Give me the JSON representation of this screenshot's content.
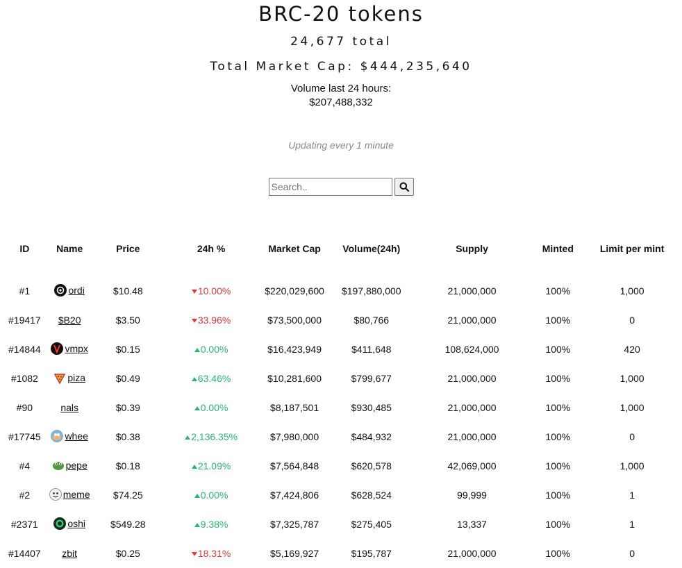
{
  "page": {
    "title": "BRC-20 tokens",
    "total": "24,677 total",
    "market_cap": "Total Market Cap: $444,235,640",
    "volume_label": "Volume last 24 hours:",
    "volume_value": "$207,488,332",
    "updating": "Updating every 1 minute"
  },
  "search": {
    "placeholder": "Search.."
  },
  "table": {
    "headers": [
      "ID",
      "Name",
      "Price",
      "24h %",
      "Market Cap",
      "Volume(24h)",
      "Supply",
      "Minted",
      "Limit per mint"
    ],
    "rows": [
      {
        "id": "#1",
        "name": "ordi",
        "icon": "ordi-logo-icon",
        "price": "$10.48",
        "change": "10.00%",
        "direction": "down",
        "market_cap": "$220,029,600",
        "volume": "$197,880,000",
        "supply": "21,000,000",
        "minted": "100%",
        "limit": "1,000"
      },
      {
        "id": "#19417",
        "name": "$B20",
        "icon": "",
        "price": "$3.50",
        "change": "33.96%",
        "direction": "down",
        "market_cap": "$73,500,000",
        "volume": "$80,766",
        "supply": "21,000,000",
        "minted": "100%",
        "limit": "0"
      },
      {
        "id": "#14844",
        "name": "vmpx",
        "icon": "vmpx-logo-icon",
        "price": "$0.15",
        "change": "0.00%",
        "direction": "up",
        "market_cap": "$16,423,949",
        "volume": "$411,648",
        "supply": "108,624,000",
        "minted": "100%",
        "limit": "420"
      },
      {
        "id": "#1082",
        "name": "piza",
        "icon": "pizza-logo-icon",
        "price": "$0.49",
        "change": "63.46%",
        "direction": "up",
        "market_cap": "$10,281,600",
        "volume": "$799,677",
        "supply": "21,000,000",
        "minted": "100%",
        "limit": "1,000"
      },
      {
        "id": "#90",
        "name": "nals",
        "icon": "",
        "price": "$0.39",
        "change": "0.00%",
        "direction": "up",
        "market_cap": "$8,187,501",
        "volume": "$930,485",
        "supply": "21,000,000",
        "minted": "100%",
        "limit": "1,000"
      },
      {
        "id": "#17745",
        "name": "whee",
        "icon": "whee-logo-icon",
        "price": "$0.38",
        "change": "2,136.35%",
        "direction": "up",
        "market_cap": "$7,980,000",
        "volume": "$484,932",
        "supply": "21,000,000",
        "minted": "100%",
        "limit": "0"
      },
      {
        "id": "#4",
        "name": "pepe",
        "icon": "pepe-logo-icon",
        "price": "$0.18",
        "change": "21.09%",
        "direction": "up",
        "market_cap": "$7,564,848",
        "volume": "$620,578",
        "supply": "42,069,000",
        "minted": "100%",
        "limit": "1,000"
      },
      {
        "id": "#2",
        "name": "meme",
        "icon": "meme-logo-icon",
        "price": "$74.25",
        "change": "0.00%",
        "direction": "up",
        "market_cap": "$7,424,806",
        "volume": "$628,524",
        "supply": "99,999",
        "minted": "100%",
        "limit": "1"
      },
      {
        "id": "#2371",
        "name": "oshi",
        "icon": "oshi-logo-icon",
        "price": "$549.28",
        "change": "9.38%",
        "direction": "up",
        "market_cap": "$7,325,787",
        "volume": "$275,405",
        "supply": "13,337",
        "minted": "100%",
        "limit": "1"
      },
      {
        "id": "#14407",
        "name": "zbit",
        "icon": "",
        "price": "$0.25",
        "change": "18.31%",
        "direction": "down",
        "market_cap": "$5,169,927",
        "volume": "$195,787",
        "supply": "21,000,000",
        "minted": "100%",
        "limit": "0"
      }
    ]
  },
  "colors": {
    "up": "#26b86f",
    "down": "#e03a3a",
    "muted": "#8a8a8a"
  }
}
